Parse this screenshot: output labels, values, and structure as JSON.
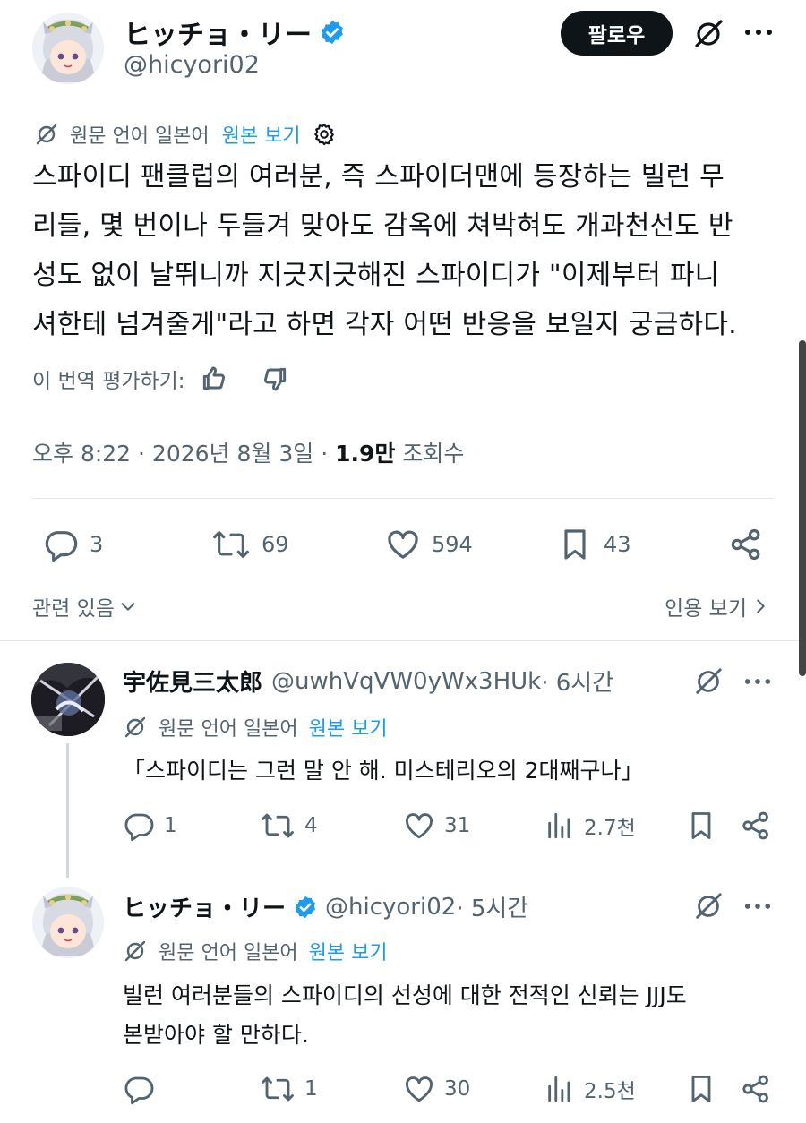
{
  "main_tweet": {
    "author_name": "ヒッチョ・リー",
    "handle": "@hicyori02",
    "follow_label": "팔로우",
    "translation_prefix": "원문 언어 일본어",
    "show_original": "원본 보기",
    "body_lines": [
      "스파이디 팬클럽의 여러분, 즉 스파이더맨에 등장하는 빌런 무",
      "리들, 몇 번이나 두들겨 맞아도 감옥에 쳐박혀도 개과천선도 반",
      "성도 없이 날뛰니까 지긋지긋해진 스파이디가 \"이제부터 파니",
      "셔한테 넘겨줄게\"라고 하면 각자 어떤 반응을 보일지 궁금하다."
    ],
    "rate_translation": "이 번역 평가하기:",
    "timestamp": "오후 8:22 · 2026년 8월 3일 · ",
    "views_count": "1.9만",
    "views_label": " 조회수",
    "stats": {
      "replies": "3",
      "reposts": "69",
      "likes": "594",
      "bookmarks": "43"
    },
    "related_label": "관련 있음",
    "quotes_label": "인용 보기"
  },
  "replies": [
    {
      "author_name": "宇佐見三太郎",
      "handle": "@uwhVqVW0yWx3HUk",
      "time": " · 6시간",
      "translation_prefix": "원문 언어 일본어",
      "show_original": "원본 보기",
      "body_lines": [
        "「스파이디는 그런 말 안 해. 미스테리오의 2대째구나」"
      ],
      "stats": {
        "replies": "1",
        "reposts": "4",
        "likes": "31",
        "views": "2.7천"
      }
    },
    {
      "author_name": "ヒッチョ・リー",
      "handle": "@hicyori02",
      "time": " · 5시간",
      "translation_prefix": "원문 언어 일본어",
      "show_original": "원본 보기",
      "body_lines": [
        "빌런 여러분들의 스파이디의 선성에 대한 전적인 신뢰는 JJJ도",
        "본받아야 할 만하다."
      ],
      "stats": {
        "replies": "",
        "reposts": "1",
        "likes": "30",
        "views": "2.5천"
      }
    }
  ],
  "colors": {
    "accent": "#1d9bf0",
    "verified": "#1d9bf0",
    "text": "#0f1419",
    "muted": "#536471",
    "follow_bg": "#0f1419"
  },
  "icons": [
    "grok-icon",
    "more-icon",
    "verified-badge-icon",
    "translate-icon",
    "gear-icon",
    "thumbs-up-icon",
    "thumbs-down-icon",
    "reply-icon",
    "repost-icon",
    "like-icon",
    "bookmark-icon",
    "share-icon",
    "views-icon",
    "chevron-down-icon",
    "chevron-right-icon"
  ]
}
